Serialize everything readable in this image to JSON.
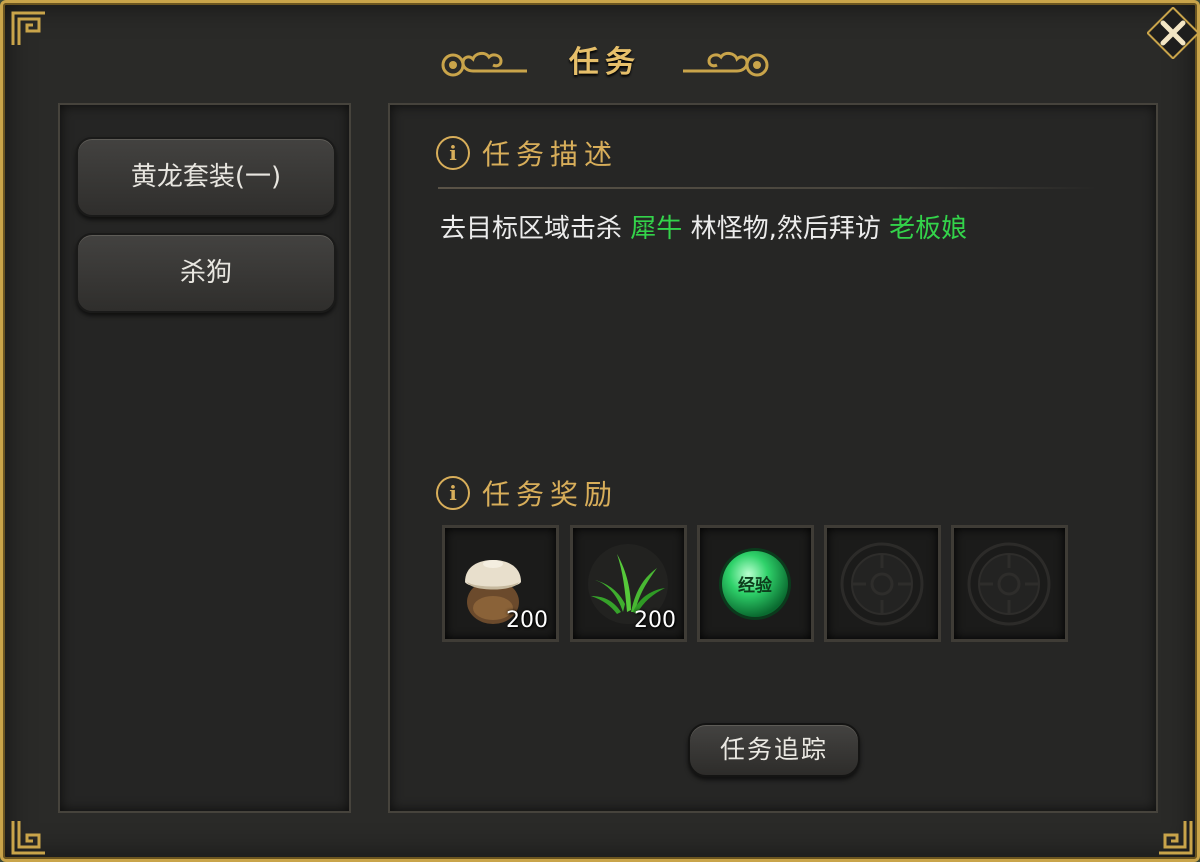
{
  "window": {
    "title": "任务"
  },
  "quest_list": [
    {
      "label": "黄龙套装(一)"
    },
    {
      "label": "杀狗"
    }
  ],
  "description": {
    "header": "任务描述",
    "text_parts": [
      "去目标区域击杀",
      "犀牛",
      "林怪物,然后拜访",
      "老板娘"
    ]
  },
  "rewards": {
    "header": "任务奖励",
    "items": [
      {
        "icon": "jar-icon",
        "quantity": "200"
      },
      {
        "icon": "herb-icon",
        "quantity": "200"
      },
      {
        "icon": "exp-orb-icon",
        "label": "经验"
      },
      {
        "icon": "empty-slot-icon"
      },
      {
        "icon": "empty-slot-icon"
      }
    ]
  },
  "buttons": {
    "track": "任务追踪",
    "close_icon": "close-icon"
  },
  "colors": {
    "gold": "#d8ae5a",
    "highlight_green": "#33d34a",
    "panel": "#262625"
  }
}
